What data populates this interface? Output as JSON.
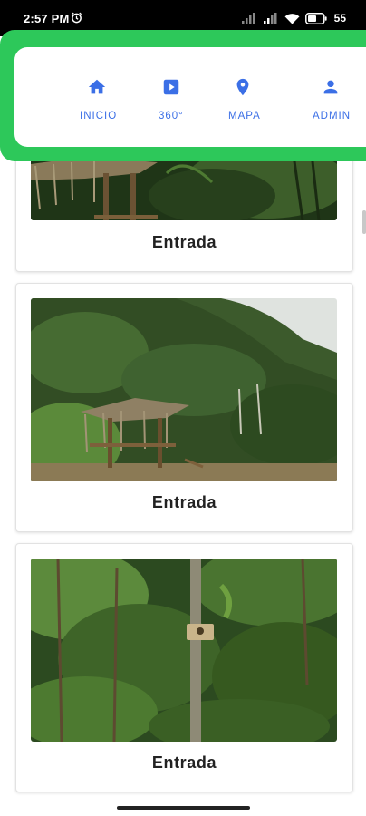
{
  "status_bar": {
    "time": "2:57 PM",
    "battery": "55",
    "icons": [
      "alarm-icon",
      "signal-icon",
      "signal-icon",
      "wifi-icon",
      "battery-icon"
    ]
  },
  "nav": {
    "accent": "#3b6fe6",
    "header_color": "#2dc85a",
    "items": [
      {
        "label": "INICIO",
        "icon": "home-icon"
      },
      {
        "label": "360°",
        "icon": "play-icon"
      },
      {
        "label": "MAPA",
        "icon": "location-pin-icon"
      },
      {
        "label": "ADMIN",
        "icon": "person-icon"
      }
    ]
  },
  "cards": [
    {
      "caption": "Entrada",
      "image": "forest-hut-roof-photo"
    },
    {
      "caption": "Entrada",
      "image": "forest-hut-hillside-photo"
    },
    {
      "caption": "Entrada",
      "image": "forest-tree-sign-photo"
    }
  ]
}
